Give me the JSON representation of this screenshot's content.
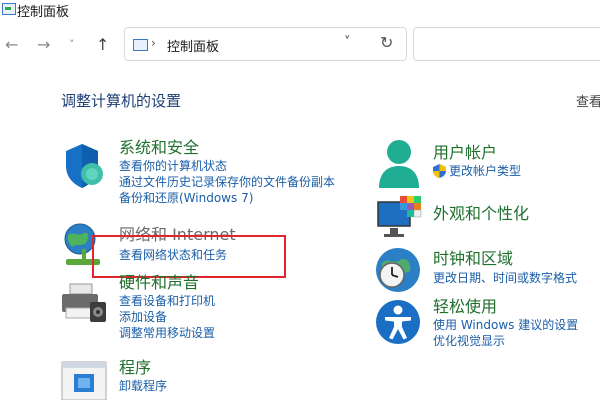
{
  "window": {
    "title": "控制面板"
  },
  "nav": {
    "back": "←",
    "forward": "→",
    "recent": "˅",
    "up": "↑"
  },
  "address": {
    "separator": "›",
    "location": "控制面板",
    "dropdown": "˅",
    "refresh": "↻"
  },
  "heading": "调整计算机的设置",
  "view_by": "查看",
  "categories": [
    {
      "title": "系统和安全",
      "links": [
        "查看你的计算机状态",
        "通过文件历史记录保存你的文件备份副本",
        "备份和还原(Windows 7)"
      ]
    },
    {
      "title": "网络和 Internet",
      "links": [
        "查看网络状态和任务"
      ]
    },
    {
      "title": "硬件和声音",
      "links": [
        "查看设备和打印机",
        "添加设备",
        "调整常用移动设置"
      ]
    },
    {
      "title": "程序",
      "links": [
        "卸载程序"
      ]
    },
    {
      "title": "用户帐户",
      "links": [
        "更改帐户类型"
      ]
    },
    {
      "title": "外观和个性化",
      "links": []
    },
    {
      "title": "时钟和区域",
      "links": [
        "更改日期、时间或数字格式"
      ]
    },
    {
      "title": "轻松使用",
      "links": [
        "使用 Windows 建议的设置",
        "优化视觉显示"
      ]
    }
  ],
  "colors": {
    "category_title": "#1f6f2d",
    "link": "#1a5ea8",
    "highlight_box": "#e0262a",
    "heading": "#1e3f75"
  }
}
